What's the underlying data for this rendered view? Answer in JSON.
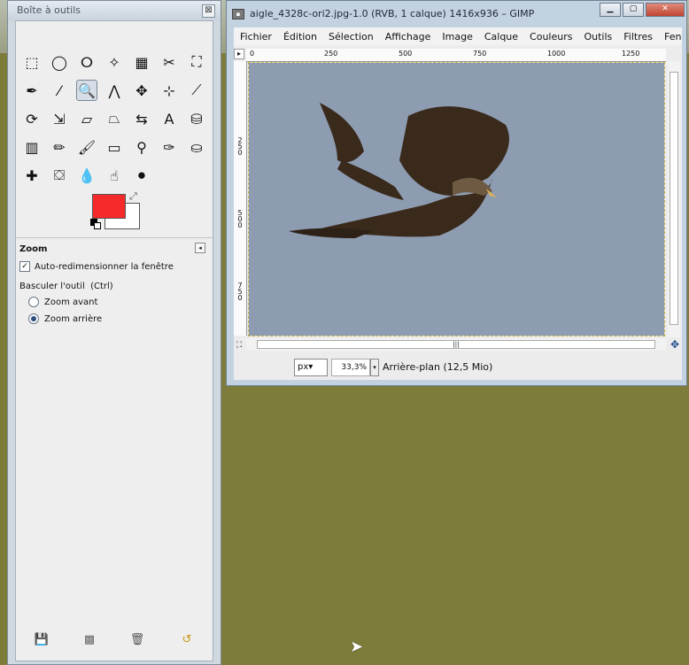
{
  "toolbox": {
    "title": "Boîte à outils",
    "close_glyph": "⊠",
    "tools": [
      {
        "name": "rect-select-icon",
        "glyph": "⬚"
      },
      {
        "name": "ellipse-select-icon",
        "glyph": "◯"
      },
      {
        "name": "free-select-icon",
        "glyph": "ⵔ"
      },
      {
        "name": "fuzzy-select-icon",
        "glyph": "✧"
      },
      {
        "name": "color-select-icon",
        "glyph": "▦"
      },
      {
        "name": "scissors-icon",
        "glyph": "✂"
      },
      {
        "name": "foreground-select-icon",
        "glyph": "⛶"
      },
      {
        "name": "paths-icon",
        "glyph": "✒"
      },
      {
        "name": "color-picker-icon",
        "glyph": "⁄"
      },
      {
        "name": "zoom-icon",
        "glyph": "🔍"
      },
      {
        "name": "measure-icon",
        "glyph": "⋀"
      },
      {
        "name": "move-icon",
        "glyph": "✥"
      },
      {
        "name": "align-icon",
        "glyph": "⊹"
      },
      {
        "name": "crop-icon",
        "glyph": "⟋"
      },
      {
        "name": "rotate-icon",
        "glyph": "⟳"
      },
      {
        "name": "scale-icon",
        "glyph": "⇲"
      },
      {
        "name": "shear-icon",
        "glyph": "▱"
      },
      {
        "name": "perspective-icon",
        "glyph": "⏢"
      },
      {
        "name": "flip-icon",
        "glyph": "⇆"
      },
      {
        "name": "text-icon",
        "glyph": "A"
      },
      {
        "name": "bucket-fill-icon",
        "glyph": "⛁"
      },
      {
        "name": "blend-icon",
        "glyph": "▥"
      },
      {
        "name": "pencil-icon",
        "glyph": "✏"
      },
      {
        "name": "paintbrush-icon",
        "glyph": "🖌"
      },
      {
        "name": "eraser-icon",
        "glyph": "▭"
      },
      {
        "name": "airbrush-icon",
        "glyph": "⚲"
      },
      {
        "name": "ink-icon",
        "glyph": "✑"
      },
      {
        "name": "clone-icon",
        "glyph": "⛀"
      },
      {
        "name": "heal-icon",
        "glyph": "✚"
      },
      {
        "name": "perspective-clone-icon",
        "glyph": "⛋"
      },
      {
        "name": "blur-icon",
        "glyph": "💧"
      },
      {
        "name": "smudge-icon",
        "glyph": "☝"
      },
      {
        "name": "dodge-burn-icon",
        "glyph": "⚫"
      }
    ],
    "colors": {
      "foreground": "#f62a2a",
      "background": "#ffffff"
    },
    "options": {
      "title": "Zoom",
      "menu_glyph": "◂",
      "auto_resize_label": "Auto-redimensionner la fenêtre",
      "auto_resize_checked": true,
      "toggle_label": "Basculer l'outil  (Ctrl)",
      "zoom_in_label": "Zoom avant",
      "zoom_out_label": "Zoom arrière",
      "selected": "zoom-out"
    },
    "bottom_icons": [
      {
        "name": "save-options-icon",
        "glyph": "💾"
      },
      {
        "name": "restore-options-icon",
        "glyph": "▩"
      },
      {
        "name": "delete-options-icon",
        "glyph": "🗑"
      },
      {
        "name": "reset-options-icon",
        "glyph": "↺"
      }
    ]
  },
  "image_window": {
    "title": "aigle_4328c-ori2.jpg-1.0 (RVB, 1 calque) 1416x936 – GIMP",
    "buttons": {
      "minimize": "▁",
      "maximize": "▢",
      "close": "✕"
    },
    "menu": [
      "Fichier",
      "Édition",
      "Sélection",
      "Affichage",
      "Image",
      "Calque",
      "Couleurs",
      "Outils",
      "Filtres",
      "Fenê"
    ],
    "hruler_labels": [
      "0",
      "250",
      "500",
      "750",
      "1000",
      "1250"
    ],
    "vruler_labels": [
      "2\n5\n0",
      "5\n0\n0",
      "7\n5\n0"
    ],
    "ruler_corner_glyph": "▸",
    "nav_glyph": "✥",
    "qm_glyph": "⛶",
    "status": {
      "unit": "px",
      "unit_arrow": "▾",
      "zoom": "33,3%",
      "zoom_arrow": "▾",
      "layer_info": "Arrière-plan (12,5 Mio)"
    },
    "canvas_bg": "#8c9bb0"
  }
}
